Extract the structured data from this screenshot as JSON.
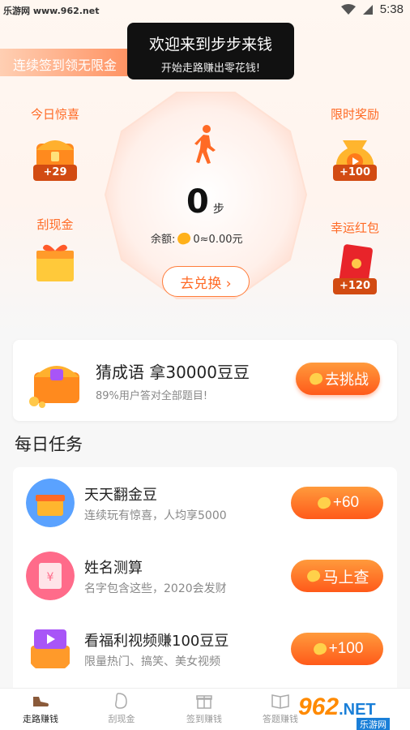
{
  "status_bar": {
    "watermark": "乐游网 www.962.net",
    "time": "5:38"
  },
  "banner": {
    "text": "连续签到领无限金"
  },
  "toast": {
    "title": "欢迎来到步步来钱",
    "subtitle": "开始走路赚出零花钱!"
  },
  "features": {
    "today_surprise": {
      "label": "今日惊喜",
      "badge": "+29"
    },
    "scratch_cash": {
      "label": "刮现金"
    },
    "limited_reward": {
      "label": "限时奖励",
      "badge": "+100"
    },
    "lucky_red_packet": {
      "label": "幸运红包",
      "badge": "+120"
    }
  },
  "steps": {
    "count": "0",
    "unit": "步",
    "balance_label": "余额:",
    "balance_value": "0≈0.00元",
    "exchange_button": "去兑换"
  },
  "idiom": {
    "title": "猜成语 拿30000豆豆",
    "subtitle": "89%用户答对全部题目!",
    "button": "去挑战"
  },
  "daily_tasks": {
    "title": "每日任务",
    "items": [
      {
        "title": "天天翻金豆",
        "desc": "连续玩有惊喜，人均享5000",
        "button": "+60"
      },
      {
        "title": "姓名测算",
        "desc": "名字包含这些，2020会发财",
        "button": "马上查"
      },
      {
        "title": "看福利视频赚100豆豆",
        "desc": "限量热门、搞笑、美女视频",
        "button": "+100"
      }
    ]
  },
  "tabbar": {
    "items": [
      {
        "label": "走路赚钱"
      },
      {
        "label": "刮现金"
      },
      {
        "label": "签到赚钱"
      },
      {
        "label": "答题赚钱"
      }
    ]
  },
  "footer_logo": {
    "main": "962",
    "domain": ".NET",
    "sub": "乐游网"
  },
  "colors": {
    "accent": "#ff6a25",
    "accent_dark": "#ff5a1a",
    "bean": "#ffb11a"
  }
}
